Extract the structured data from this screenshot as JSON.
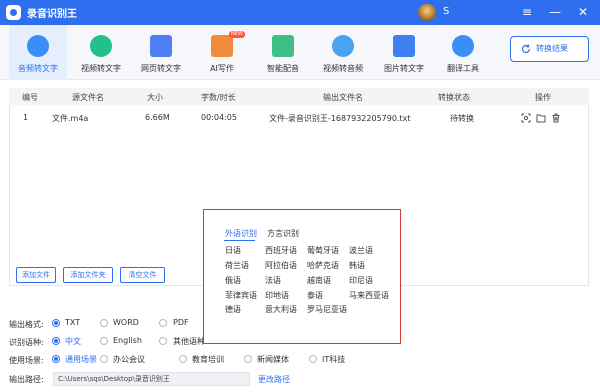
{
  "app": {
    "title": "录音识别王",
    "user": "S"
  },
  "window_controls": [
    "≡",
    "—",
    "✕"
  ],
  "toolbar": {
    "tools": [
      {
        "label": "音频转文字",
        "icon": "audio-text-icon",
        "color": "#3a8ef6"
      },
      {
        "label": "视频转文字",
        "icon": "video-text-icon",
        "color": "#22c08a"
      },
      {
        "label": "网页转文字",
        "icon": "webpage-text-icon",
        "color": "#4f7ef5"
      },
      {
        "label": "AI写作",
        "icon": "ai-writing-icon",
        "color": "#f08c3b",
        "badge": "NEW"
      },
      {
        "label": "智能配音",
        "icon": "dubbing-icon",
        "color": "#3fbf86"
      },
      {
        "label": "视频转音频",
        "icon": "video-audio-icon",
        "color": "#4aa3f0"
      },
      {
        "label": "图片转文字",
        "icon": "image-text-icon",
        "color": "#3e7ff2"
      },
      {
        "label": "翻译工具",
        "icon": "translate-icon",
        "color": "#3a8ef6"
      }
    ],
    "convert_result": "转换结果"
  },
  "table": {
    "headers": [
      "编号",
      "源文件名",
      "大小",
      "字数/时长",
      "输出文件名",
      "转换状态",
      "操作"
    ],
    "rows": [
      {
        "id": "1",
        "source": "文件.m4a",
        "size": "6.66M",
        "duration": "00:04:05",
        "output": "文件-录音识别王-1687932205790.txt",
        "status": "待转换"
      }
    ]
  },
  "buttons": {
    "add_file": "添加文件",
    "add_folder": "添加文件夹",
    "clear_files": "清空文件"
  },
  "form": {
    "output_format": {
      "label": "输出格式:",
      "options": [
        "TXT",
        "WORD",
        "PDF"
      ],
      "selected": "TXT"
    },
    "language": {
      "label": "识别语种:",
      "options": [
        "中文",
        "English",
        "其他语种"
      ],
      "selected": "中文"
    },
    "scenario": {
      "label": "使用场景:",
      "options": [
        "通用场景",
        "办公会议",
        "教育培训",
        "新闻媒体",
        "IT科技"
      ],
      "selected": "通用场景"
    },
    "output_path": {
      "label": "输出路径:",
      "value": "C:\\Users\\sqs\\Desktop\\录音识别王",
      "change": "更改路径"
    }
  },
  "lang_popup": {
    "tabs": [
      "外语识别",
      "方言识别"
    ],
    "active_tab": "外语识别",
    "languages": [
      [
        "日语",
        "西班牙语",
        "葡萄牙语",
        "波兰语"
      ],
      [
        "荷兰语",
        "阿拉伯语",
        "哈萨克语",
        "韩语"
      ],
      [
        "俄语",
        "法语",
        "越南语",
        "印尼语"
      ],
      [
        "菲律宾语",
        "印地语",
        "泰语",
        "马来西亚语"
      ],
      [
        "德语",
        "意大利语",
        "罗马尼亚语"
      ]
    ]
  },
  "colors": {
    "brand": "#2e6ff0",
    "highlight_border": "#d73a3a"
  }
}
